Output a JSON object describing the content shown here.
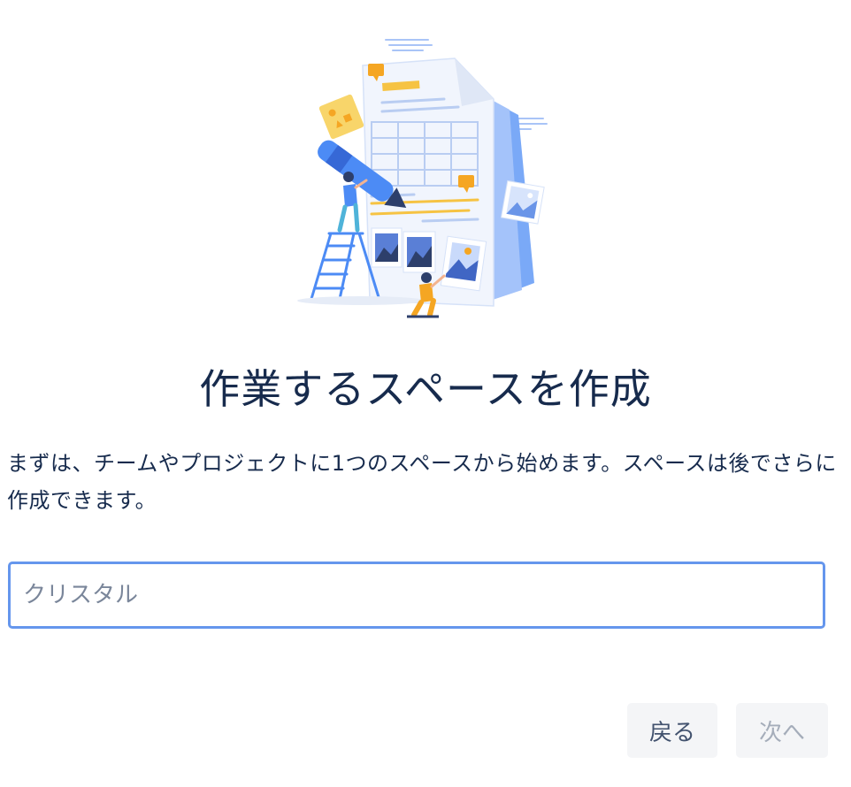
{
  "page": {
    "title": "作業するスペースを作成",
    "description": "まずは、チームやプロジェクトに1つのスペースから始めます。スペースは後でさらに作成できます。"
  },
  "space_name_input": {
    "placeholder": "クリスタル",
    "value": ""
  },
  "footer": {
    "back_label": "戻る",
    "next_label": "次へ"
  },
  "illustration": {
    "icon": "document-collaboration-illustration"
  },
  "colors": {
    "text": "#172b4d",
    "input_focus_border": "#6596ed",
    "button_bg": "#f4f5f7",
    "disabled_text": "#a5adba",
    "accent_blue": "#4c8bf5",
    "accent_orange": "#f5a623",
    "accent_yellow": "#f6c343"
  }
}
